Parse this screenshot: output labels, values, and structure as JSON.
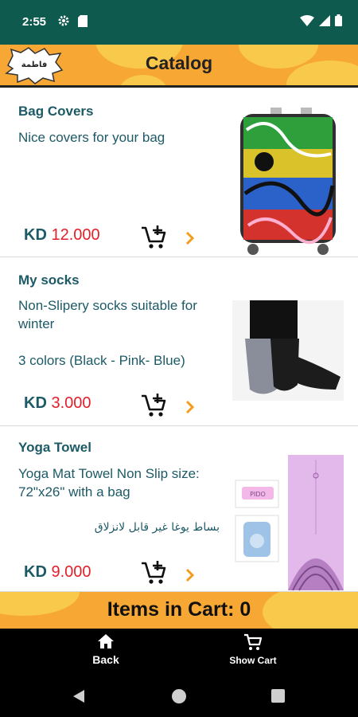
{
  "status_bar": {
    "time": "2:55"
  },
  "header": {
    "title": "Catalog",
    "logo_text": "فاطمة"
  },
  "products": [
    {
      "title": "Bag Covers",
      "description": "Nice covers for your bag",
      "currency": "KD",
      "price": "12.000"
    },
    {
      "title": "My socks",
      "description": "Non-Slipery socks suitable for winter\n\n3 colors (Black - Pink- Blue)",
      "currency": "KD",
      "price": "3.000"
    },
    {
      "title": "Yoga Towel",
      "description": "Yoga Mat Towel Non Slip size: 72\"x26\" with a bag",
      "arabic_description": "بساط يوغا غير قابل لانزلاق",
      "currency": "KD",
      "price": "9.000",
      "tag_text": "PIDO"
    }
  ],
  "cart_bar": {
    "label": "Items in Cart: 0"
  },
  "bottom_nav": {
    "back_label": "Back",
    "show_cart_label": "Show Cart"
  },
  "colors": {
    "status_bar": "#0e5a4f",
    "header": "#f7a734",
    "text_primary": "#1d5a66",
    "price": "#e2202b",
    "accent_chevron": "#f39c1f"
  }
}
